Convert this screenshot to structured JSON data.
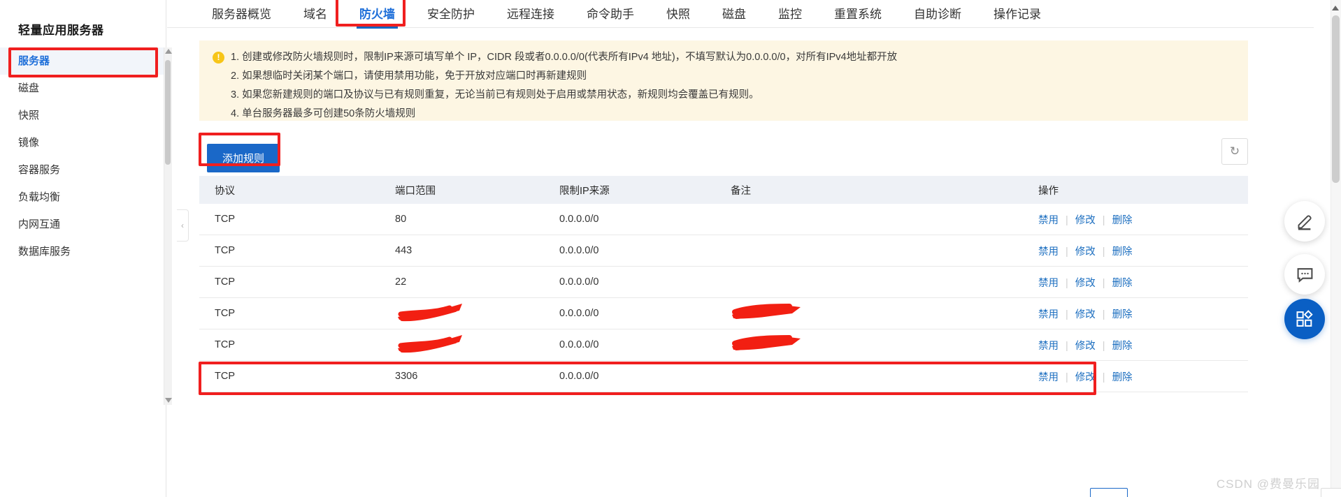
{
  "sidebar": {
    "title": "轻量应用服务器",
    "items": [
      {
        "label": "服务器",
        "active": true
      },
      {
        "label": "磁盘",
        "active": false
      },
      {
        "label": "快照",
        "active": false
      },
      {
        "label": "镜像",
        "active": false
      },
      {
        "label": "容器服务",
        "active": false
      },
      {
        "label": "负载均衡",
        "active": false
      },
      {
        "label": "内网互通",
        "active": false
      },
      {
        "label": "数据库服务",
        "active": false
      }
    ]
  },
  "tabs": [
    {
      "label": "服务器概览",
      "active": false
    },
    {
      "label": "域名",
      "active": false
    },
    {
      "label": "防火墙",
      "active": true
    },
    {
      "label": "安全防护",
      "active": false
    },
    {
      "label": "远程连接",
      "active": false
    },
    {
      "label": "命令助手",
      "active": false
    },
    {
      "label": "快照",
      "active": false
    },
    {
      "label": "磁盘",
      "active": false
    },
    {
      "label": "监控",
      "active": false
    },
    {
      "label": "重置系统",
      "active": false
    },
    {
      "label": "自助诊断",
      "active": false
    },
    {
      "label": "操作记录",
      "active": false
    }
  ],
  "notice": {
    "icon": "!",
    "lines": [
      "1. 创建或修改防火墙规则时，限制IP来源可填写单个 IP，CIDR 段或者0.0.0.0/0(代表所有IPv4 地址)，不填写默认为0.0.0.0/0，对所有IPv4地址都开放",
      "2. 如果想临时关闭某个端口，请使用禁用功能，免于开放对应端口时再新建规则",
      "3. 如果您新建规则的端口及协议与已有规则重复，无论当前已有规则处于启用或禁用状态，新规则均会覆盖已有规则。",
      "4. 单台服务器最多可创建50条防火墙规则"
    ]
  },
  "toolbar": {
    "add_rule_label": "添加规则",
    "refresh_icon": "↻"
  },
  "table": {
    "headers": [
      "协议",
      "端口范围",
      "限制IP来源",
      "备注",
      "操作"
    ],
    "actions": {
      "disable": "禁用",
      "modify": "修改",
      "delete": "删除",
      "separator": "|"
    },
    "rows": [
      {
        "protocol": "TCP",
        "port": "80",
        "source": "0.0.0.0/0",
        "note": "",
        "port_redacted": false,
        "note_redacted": false,
        "highlighted": false
      },
      {
        "protocol": "TCP",
        "port": "443",
        "source": "0.0.0.0/0",
        "note": "",
        "port_redacted": false,
        "note_redacted": false,
        "highlighted": false
      },
      {
        "protocol": "TCP",
        "port": "22",
        "source": "0.0.0.0/0",
        "note": "",
        "port_redacted": false,
        "note_redacted": false,
        "highlighted": false
      },
      {
        "protocol": "TCP",
        "port": "",
        "source": "0.0.0.0/0",
        "note": "",
        "port_redacted": true,
        "note_redacted": true,
        "highlighted": false
      },
      {
        "protocol": "TCP",
        "port": "",
        "source": "0.0.0.0/0",
        "note": "",
        "port_redacted": true,
        "note_redacted": true,
        "highlighted": false
      },
      {
        "protocol": "TCP",
        "port": "3306",
        "source": "0.0.0.0/0",
        "note": "",
        "port_redacted": false,
        "note_redacted": false,
        "highlighted": true
      }
    ]
  },
  "float_buttons": [
    {
      "name": "edit-icon",
      "glyph": "✎"
    },
    {
      "name": "chat-icon",
      "glyph": "💬"
    },
    {
      "name": "apps-icon",
      "glyph": "▦"
    }
  ],
  "collapse_handle": "‹",
  "watermark": "CSDN @费曼乐园",
  "colors": {
    "accent": "#1a68c8",
    "annotation": "#f01f1f",
    "notice_bg": "#fdf6e3",
    "header_bg": "#eef1f6",
    "link": "#1d6fc0"
  }
}
